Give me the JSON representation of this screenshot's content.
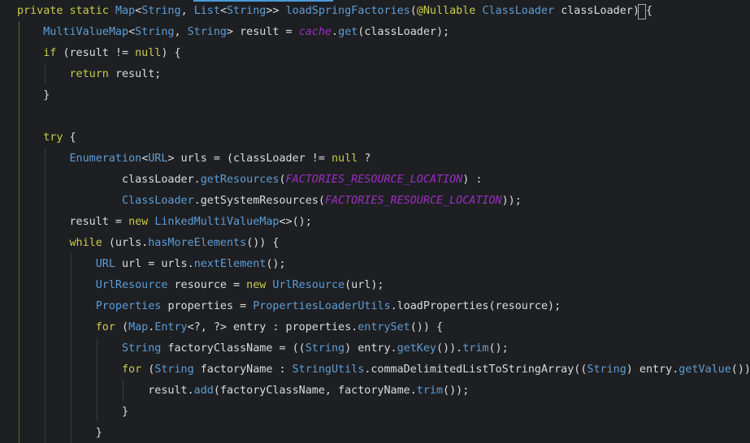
{
  "editor": {
    "lines": [
      {
        "tokens": [
          {
            "t": "private static ",
            "c": "kw"
          },
          {
            "t": "Map",
            "c": "ty"
          },
          {
            "t": "<",
            "c": "pu"
          },
          {
            "t": "String",
            "c": "ty"
          },
          {
            "t": ", ",
            "c": "pu"
          },
          {
            "t": "List",
            "c": "ty"
          },
          {
            "t": "<",
            "c": "pu"
          },
          {
            "t": "String",
            "c": "ty"
          },
          {
            "t": ">> ",
            "c": "pu"
          },
          {
            "t": "loadSpringFactories",
            "c": "fn"
          },
          {
            "t": "(",
            "c": "pu"
          },
          {
            "t": "@Nullable ",
            "c": "an"
          },
          {
            "t": "ClassLoader ",
            "c": "ty"
          },
          {
            "t": "classLoader",
            "c": "pl"
          },
          {
            "t": ") {",
            "c": "pu"
          }
        ]
      },
      {
        "tokens": [
          {
            "t": "    MultiValueMap",
            "c": "ty"
          },
          {
            "t": "<",
            "c": "pu"
          },
          {
            "t": "String",
            "c": "ty"
          },
          {
            "t": ", ",
            "c": "pu"
          },
          {
            "t": "String",
            "c": "ty"
          },
          {
            "t": "> result = ",
            "c": "pl"
          },
          {
            "t": "cache",
            "c": "it"
          },
          {
            "t": ".",
            "c": "pu"
          },
          {
            "t": "get",
            "c": "fn"
          },
          {
            "t": "(classLoader);",
            "c": "pl"
          }
        ]
      },
      {
        "tokens": [
          {
            "t": "    if ",
            "c": "kw"
          },
          {
            "t": "(result != ",
            "c": "pl"
          },
          {
            "t": "null",
            "c": "kw"
          },
          {
            "t": ") {",
            "c": "pl"
          }
        ]
      },
      {
        "tokens": [
          {
            "t": "        return ",
            "c": "kw"
          },
          {
            "t": "result;",
            "c": "pl"
          }
        ]
      },
      {
        "tokens": [
          {
            "t": "    }",
            "c": "pl"
          }
        ]
      },
      {
        "tokens": []
      },
      {
        "tokens": [
          {
            "t": "    try ",
            "c": "kw"
          },
          {
            "t": "{",
            "c": "pl"
          }
        ]
      },
      {
        "tokens": [
          {
            "t": "        Enumeration",
            "c": "ty"
          },
          {
            "t": "<",
            "c": "pu"
          },
          {
            "t": "URL",
            "c": "ty"
          },
          {
            "t": "> urls = (classLoader != ",
            "c": "pl"
          },
          {
            "t": "null ",
            "c": "kw"
          },
          {
            "t": "?",
            "c": "pl"
          }
        ]
      },
      {
        "tokens": [
          {
            "t": "                classLoader.",
            "c": "pl"
          },
          {
            "t": "getResources",
            "c": "fn"
          },
          {
            "t": "(",
            "c": "pl"
          },
          {
            "t": "FACTORIES_RESOURCE_LOCATION",
            "c": "it"
          },
          {
            "t": ") :",
            "c": "pl"
          }
        ]
      },
      {
        "tokens": [
          {
            "t": "                ClassLoader",
            "c": "ty"
          },
          {
            "t": ".getSystemResources(",
            "c": "pl"
          },
          {
            "t": "FACTORIES_RESOURCE_LOCATION",
            "c": "it"
          },
          {
            "t": "));",
            "c": "pl"
          }
        ]
      },
      {
        "tokens": [
          {
            "t": "        result = ",
            "c": "pl"
          },
          {
            "t": "new ",
            "c": "kw"
          },
          {
            "t": "LinkedMultiValueMap",
            "c": "ty"
          },
          {
            "t": "<>();",
            "c": "pl"
          }
        ]
      },
      {
        "tokens": [
          {
            "t": "        while ",
            "c": "kw"
          },
          {
            "t": "(urls.",
            "c": "pl"
          },
          {
            "t": "hasMoreElements",
            "c": "fn"
          },
          {
            "t": "()) {",
            "c": "pl"
          }
        ]
      },
      {
        "tokens": [
          {
            "t": "            URL ",
            "c": "ty"
          },
          {
            "t": "url = urls.",
            "c": "pl"
          },
          {
            "t": "nextElement",
            "c": "fn"
          },
          {
            "t": "();",
            "c": "pl"
          }
        ]
      },
      {
        "tokens": [
          {
            "t": "            UrlResource ",
            "c": "ty"
          },
          {
            "t": "resource = ",
            "c": "pl"
          },
          {
            "t": "new ",
            "c": "kw"
          },
          {
            "t": "UrlResource",
            "c": "ty"
          },
          {
            "t": "(url);",
            "c": "pl"
          }
        ]
      },
      {
        "tokens": [
          {
            "t": "            Properties ",
            "c": "ty"
          },
          {
            "t": "properties = ",
            "c": "pl"
          },
          {
            "t": "PropertiesLoaderUtils",
            "c": "ty"
          },
          {
            "t": ".loadProperties(resource);",
            "c": "pl"
          }
        ]
      },
      {
        "tokens": [
          {
            "t": "            for ",
            "c": "kw"
          },
          {
            "t": "(",
            "c": "pl"
          },
          {
            "t": "Map",
            "c": "ty"
          },
          {
            "t": ".",
            "c": "pl"
          },
          {
            "t": "Entry",
            "c": "ty"
          },
          {
            "t": "<?, ?> entry : properties.",
            "c": "pl"
          },
          {
            "t": "entrySet",
            "c": "fn"
          },
          {
            "t": "()) {",
            "c": "pl"
          }
        ]
      },
      {
        "tokens": [
          {
            "t": "                String ",
            "c": "ty"
          },
          {
            "t": "factoryClassName = ((",
            "c": "pl"
          },
          {
            "t": "String",
            "c": "ty"
          },
          {
            "t": ") entry.",
            "c": "pl"
          },
          {
            "t": "getKey",
            "c": "fn"
          },
          {
            "t": "()).",
            "c": "pl"
          },
          {
            "t": "trim",
            "c": "fn"
          },
          {
            "t": "();",
            "c": "pl"
          }
        ]
      },
      {
        "tokens": [
          {
            "t": "                for ",
            "c": "kw"
          },
          {
            "t": "(",
            "c": "pl"
          },
          {
            "t": "String ",
            "c": "ty"
          },
          {
            "t": "factoryName : ",
            "c": "pl"
          },
          {
            "t": "StringUtils",
            "c": "ty"
          },
          {
            "t": ".commaDelimitedListToStringArray((",
            "c": "pl"
          },
          {
            "t": "String",
            "c": "ty"
          },
          {
            "t": ") entry.",
            "c": "pl"
          },
          {
            "t": "getValue",
            "c": "fn"
          },
          {
            "t": "()))",
            "c": "pl"
          }
        ]
      },
      {
        "tokens": [
          {
            "t": "                    result.",
            "c": "pl"
          },
          {
            "t": "add",
            "c": "fn"
          },
          {
            "t": "(factoryClassName, factoryName.",
            "c": "pl"
          },
          {
            "t": "trim",
            "c": "fn"
          },
          {
            "t": "());",
            "c": "pl"
          }
        ]
      },
      {
        "tokens": [
          {
            "t": "                }",
            "c": "pl"
          }
        ]
      },
      {
        "tokens": [
          {
            "t": "            }",
            "c": "pl"
          }
        ]
      }
    ]
  },
  "colors": {
    "background": "#1e1f22",
    "keyword": "#c8cc4a",
    "type": "#5d9dd6",
    "plain": "#dcdcdc",
    "italic_field": "#9a2fc2",
    "indent_guide": "#393b40",
    "active_guide": "#5b6b2a",
    "tab_accent": "#4b9ad8"
  }
}
